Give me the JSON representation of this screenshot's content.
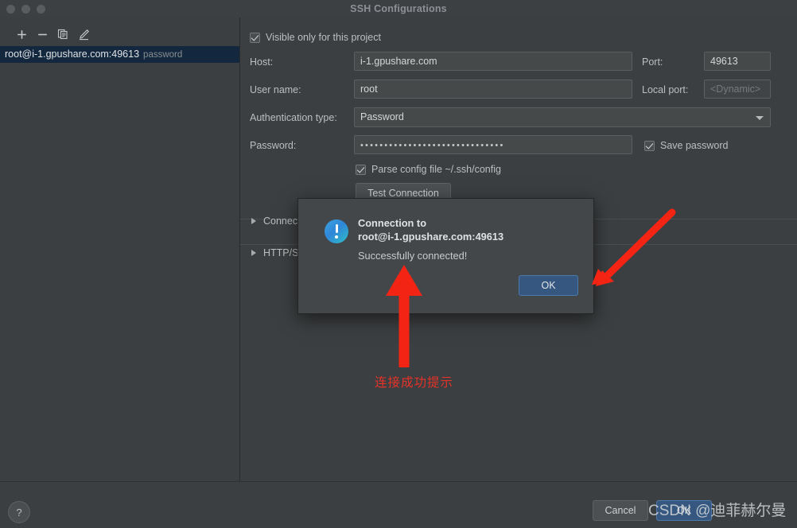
{
  "window": {
    "title": "SSH Configurations"
  },
  "sidebar": {
    "toolbar": [
      {
        "name": "add-button",
        "icon": "plus-icon",
        "label": "+"
      },
      {
        "name": "remove-button",
        "icon": "minus-icon",
        "label": "−"
      },
      {
        "name": "copy-button",
        "icon": "copy-icon",
        "label": "Copy"
      },
      {
        "name": "edit-button",
        "icon": "pencil-icon",
        "label": "Edit"
      }
    ],
    "items": [
      {
        "label": "root@i-1.gpushare.com:49613",
        "tag": "password",
        "selected": true
      }
    ]
  },
  "form": {
    "visible_only_checkbox": {
      "label": "Visible only for this project",
      "checked": true
    },
    "host": {
      "label": "Host:",
      "value": "i-1.gpushare.com"
    },
    "port": {
      "label": "Port:",
      "value": "49613"
    },
    "username": {
      "label": "User name:",
      "value": "root"
    },
    "local_port": {
      "label": "Local port:",
      "placeholder": "<Dynamic>",
      "value": ""
    },
    "auth_type": {
      "label": "Authentication type:",
      "value": "Password"
    },
    "password": {
      "label": "Password:",
      "value": "••••••••••••••••••••••••••••••"
    },
    "save_password_checkbox": {
      "label": "Save password",
      "checked": true
    },
    "parse_config_checkbox": {
      "label": "Parse config file ~/.ssh/config",
      "checked": true
    },
    "test_connection_button": {
      "label": "Test Connection"
    },
    "sections": [
      {
        "label": "Connection",
        "expanded": false
      },
      {
        "label": "HTTP/S",
        "expanded": false
      }
    ]
  },
  "footer": {
    "help_label": "?",
    "cancel_label": "Cancel",
    "ok_label": "OK"
  },
  "dialog": {
    "title_line1": "Connection to",
    "title_line2": "root@i-1.gpushare.com:49613",
    "message": "Successfully connected!",
    "ok_label": "OK",
    "icon": "info-exclamation-icon"
  },
  "annotations": {
    "note_text": "连接成功提示",
    "arrow_color": "#f42414"
  },
  "watermark": {
    "text": "CSDN @迪菲赫尔曼"
  },
  "colors": {
    "window_bg": "#3c3f41",
    "titlebar_bg": "#3c4043",
    "field_bg": "#45494a",
    "selection_bg": "#13283f",
    "accent_blue": "#365880",
    "annotation_red": "#f42414"
  }
}
